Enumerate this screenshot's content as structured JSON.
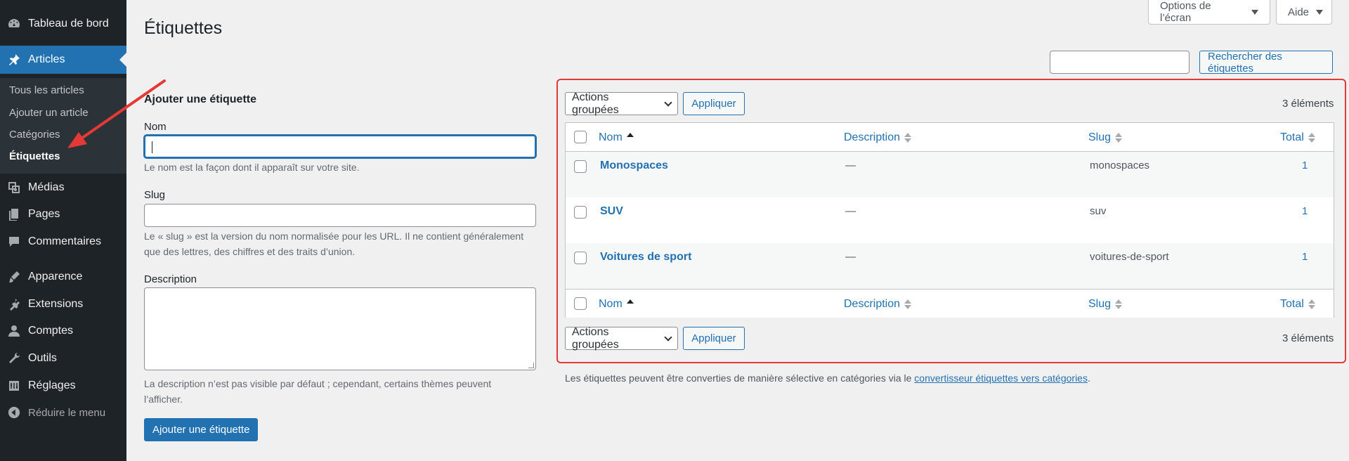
{
  "sidebar": {
    "items": [
      {
        "label": "Tableau de bord",
        "icon": "dashboard-icon"
      },
      {
        "label": "Articles",
        "icon": "pin-icon"
      },
      {
        "label": "Médias",
        "icon": "media-icon"
      },
      {
        "label": "Pages",
        "icon": "pages-icon"
      },
      {
        "label": "Commentaires",
        "icon": "comments-icon"
      },
      {
        "label": "Apparence",
        "icon": "brush-icon"
      },
      {
        "label": "Extensions",
        "icon": "plugin-icon"
      },
      {
        "label": "Comptes",
        "icon": "user-icon"
      },
      {
        "label": "Outils",
        "icon": "wrench-icon"
      },
      {
        "label": "Réglages",
        "icon": "settings-icon"
      },
      {
        "label": "Réduire le menu",
        "icon": "collapse-icon"
      }
    ],
    "submenu": [
      "Tous les articles",
      "Ajouter un article",
      "Catégories",
      "Étiquettes"
    ]
  },
  "header": {
    "screen_options": "Options de l’écran",
    "help": "Aide",
    "title": "Étiquettes",
    "search_button": "Rechercher des étiquettes",
    "search_value": ""
  },
  "form": {
    "title": "Ajouter une étiquette",
    "name_label": "Nom",
    "name_value": "",
    "name_help": "Le nom est la façon dont il apparaît sur votre site.",
    "slug_label": "Slug",
    "slug_help_1": "Le « slug » est la version du nom normalisée pour les URL. Il ne contient généralement",
    "slug_help_2": "que des lettres, des chiffres et des traits d’union.",
    "desc_label": "Description",
    "desc_help_1": "La description n’est pas visible par défaut ; cependant, certains thèmes peuvent",
    "desc_help_2": "l’afficher.",
    "submit": "Ajouter une étiquette"
  },
  "table": {
    "bulk_actions": "Actions groupées",
    "apply": "Appliquer",
    "count": "3 éléments",
    "columns": [
      "Nom",
      "Description",
      "Slug",
      "Total"
    ],
    "rows": [
      {
        "name": "Monospaces",
        "description": "—",
        "slug": "monospaces",
        "total": "1"
      },
      {
        "name": "SUV",
        "description": "—",
        "slug": "suv",
        "total": "1"
      },
      {
        "name": "Voitures de sport",
        "description": "—",
        "slug": "voitures-de-sport",
        "total": "1"
      }
    ]
  },
  "note": {
    "text": "Les étiquettes peuvent être converties de manière sélective en catégories via le ",
    "link": "convertisseur étiquettes vers catégories",
    "end": "."
  },
  "colors": {
    "accent": "#2271b1",
    "sidebar": "#1d2327",
    "highlight": "#e53935"
  }
}
